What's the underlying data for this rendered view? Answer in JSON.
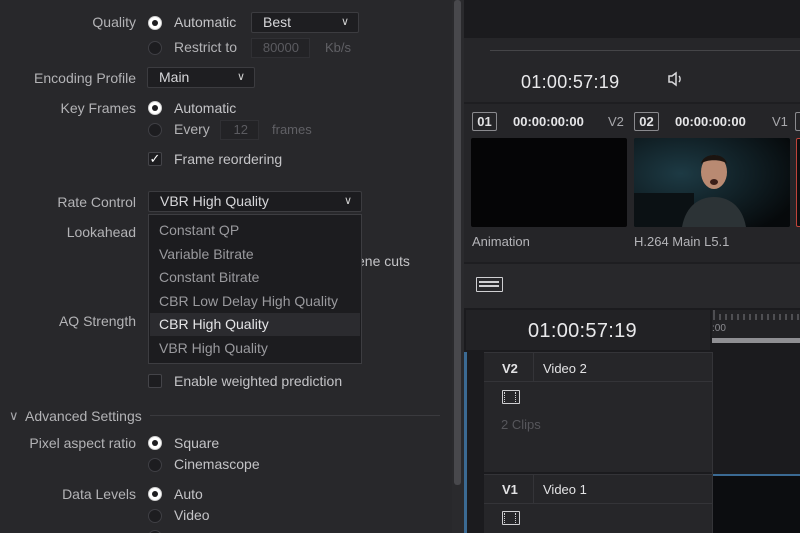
{
  "settings": {
    "quality": {
      "label": "Quality",
      "auto_label": "Automatic",
      "auto_value": "Best",
      "restrict_label": "Restrict to",
      "restrict_value": "80000",
      "restrict_unit": "Kb/s"
    },
    "encoding_profile": {
      "label": "Encoding Profile",
      "value": "Main"
    },
    "key_frames": {
      "label": "Key Frames",
      "auto_label": "Automatic",
      "every_label": "Every",
      "every_value": "12",
      "every_unit": "frames",
      "reorder_label": "Frame reordering",
      "reorder_checked": true
    },
    "rate_control": {
      "label": "Rate Control",
      "value": "VBR High Quality",
      "options": [
        "Constant QP",
        "Variable Bitrate",
        "Constant Bitrate",
        "CBR Low Delay High Quality",
        "CBR High Quality",
        "VBR High Quality"
      ],
      "highlighted": "CBR High Quality"
    },
    "lookahead": {
      "label": "Lookahead",
      "partial_text": "ene cuts"
    },
    "aq_strength": {
      "label": "AQ Strength"
    },
    "weighted_prediction": {
      "label": "Enable weighted prediction",
      "checked": false
    },
    "advanced": {
      "label": "Advanced Settings"
    },
    "pixel_aspect": {
      "label": "Pixel aspect ratio",
      "options": [
        "Square",
        "Cinemascope"
      ],
      "selected": "Square"
    },
    "data_levels": {
      "label": "Data Levels",
      "options": [
        "Auto",
        "Video"
      ],
      "selected": "Auto"
    }
  },
  "viewer": {
    "timecode": "01:00:57:19",
    "icon": "speaker-icon"
  },
  "clips": [
    {
      "index": "01",
      "timecode": "00:00:00:00",
      "track": "V2",
      "caption": "Animation"
    },
    {
      "index": "02",
      "timecode": "00:00:00:00",
      "track": "V1",
      "caption": "H.264 Main L5.1"
    }
  ],
  "timeline": {
    "timecode": "01:00:57:19",
    "ruler_label": ":00",
    "tracks": [
      {
        "id": "V2",
        "name": "Video 2",
        "note": "2 Clips"
      },
      {
        "id": "V1",
        "name": "Video 1"
      }
    ]
  },
  "colors": {
    "panel": "#28282b",
    "accent_blue": "#3b6a93",
    "clip_selected_border": "#c0443a"
  }
}
